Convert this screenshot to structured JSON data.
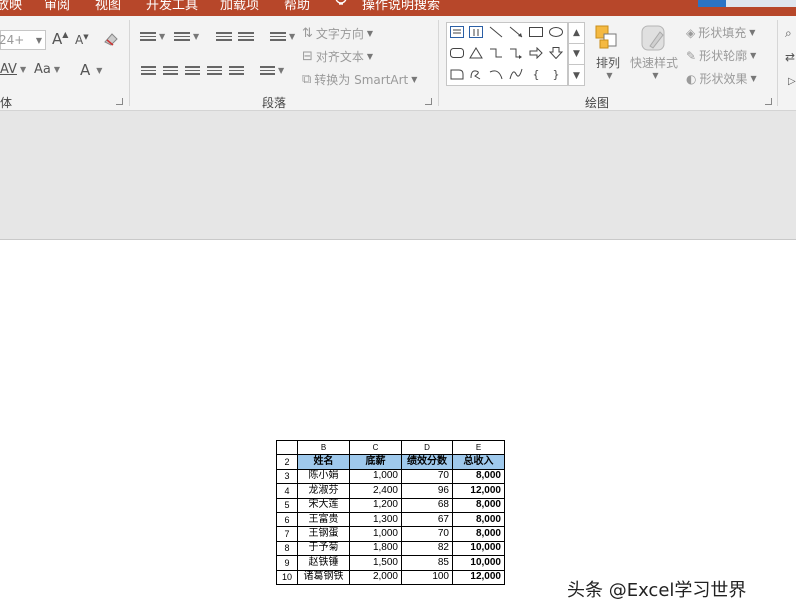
{
  "tabs": [
    "放映",
    "审阅",
    "视图",
    "开发工具",
    "加载项",
    "帮助",
    "操作说明搜索"
  ],
  "font_group": {
    "label": "体",
    "font_size_value": "24+",
    "grow_font": "A",
    "shrink_font": "A",
    "spacing": "AV",
    "change_case": "Aa",
    "font_color": "A"
  },
  "paragraph_group": {
    "label": "段落",
    "text_direction": "文字方向",
    "align_text": "对齐文本",
    "convert_smartart": "转换为 SmartArt"
  },
  "drawing_group": {
    "label": "绘图",
    "arrange": "排列",
    "quick_styles": "快速样式",
    "shape_fill": "形状填充",
    "shape_outline": "形状轮廓",
    "shape_effects": "形状效果"
  },
  "shapes_gallery": {
    "row1": [
      "文本框",
      "竖排文本框",
      "直线",
      "箭头",
      "矩形",
      "椭圆"
    ],
    "row2": [
      "圆角矩形",
      "三角形",
      "肘形连接符",
      "肘形箭头",
      "右箭头",
      "下箭头"
    ],
    "row3": [
      "单圆角矩形",
      "任意多边形",
      "弧形",
      "曲线",
      "左大括号",
      "右大括号"
    ]
  },
  "table": {
    "col_headers": [
      "B",
      "C",
      "D",
      "E"
    ],
    "header_row_number": "2",
    "headers": [
      "姓名",
      "底薪",
      "绩效分数",
      "总收入"
    ],
    "rows": [
      {
        "row": "3",
        "name": "陈小娟",
        "base": "1,000",
        "score": "70",
        "total": "8,000"
      },
      {
        "row": "4",
        "name": "龙淑芬",
        "base": "2,400",
        "score": "96",
        "total": "12,000"
      },
      {
        "row": "5",
        "name": "宋大莲",
        "base": "1,200",
        "score": "68",
        "total": "8,000"
      },
      {
        "row": "6",
        "name": "王富贵",
        "base": "1,300",
        "score": "67",
        "total": "8,000"
      },
      {
        "row": "7",
        "name": "王钢蛋",
        "base": "1,000",
        "score": "70",
        "total": "8,000"
      },
      {
        "row": "8",
        "name": "于予菊",
        "base": "1,800",
        "score": "82",
        "total": "10,000"
      },
      {
        "row": "9",
        "name": "赵铁锤",
        "base": "1,500",
        "score": "85",
        "total": "10,000"
      },
      {
        "row": "10",
        "name": "诸葛钢铁",
        "base": "2,000",
        "score": "100",
        "total": "12,000"
      }
    ]
  },
  "watermark": "头条 @Excel学习世界",
  "colors": {
    "ribbon_tab_bg": "#b7472a",
    "ribbon_bg": "#f3f3f3",
    "pane_bg": "#e6e6e6",
    "table_header_bg": "#9fc9ec"
  }
}
